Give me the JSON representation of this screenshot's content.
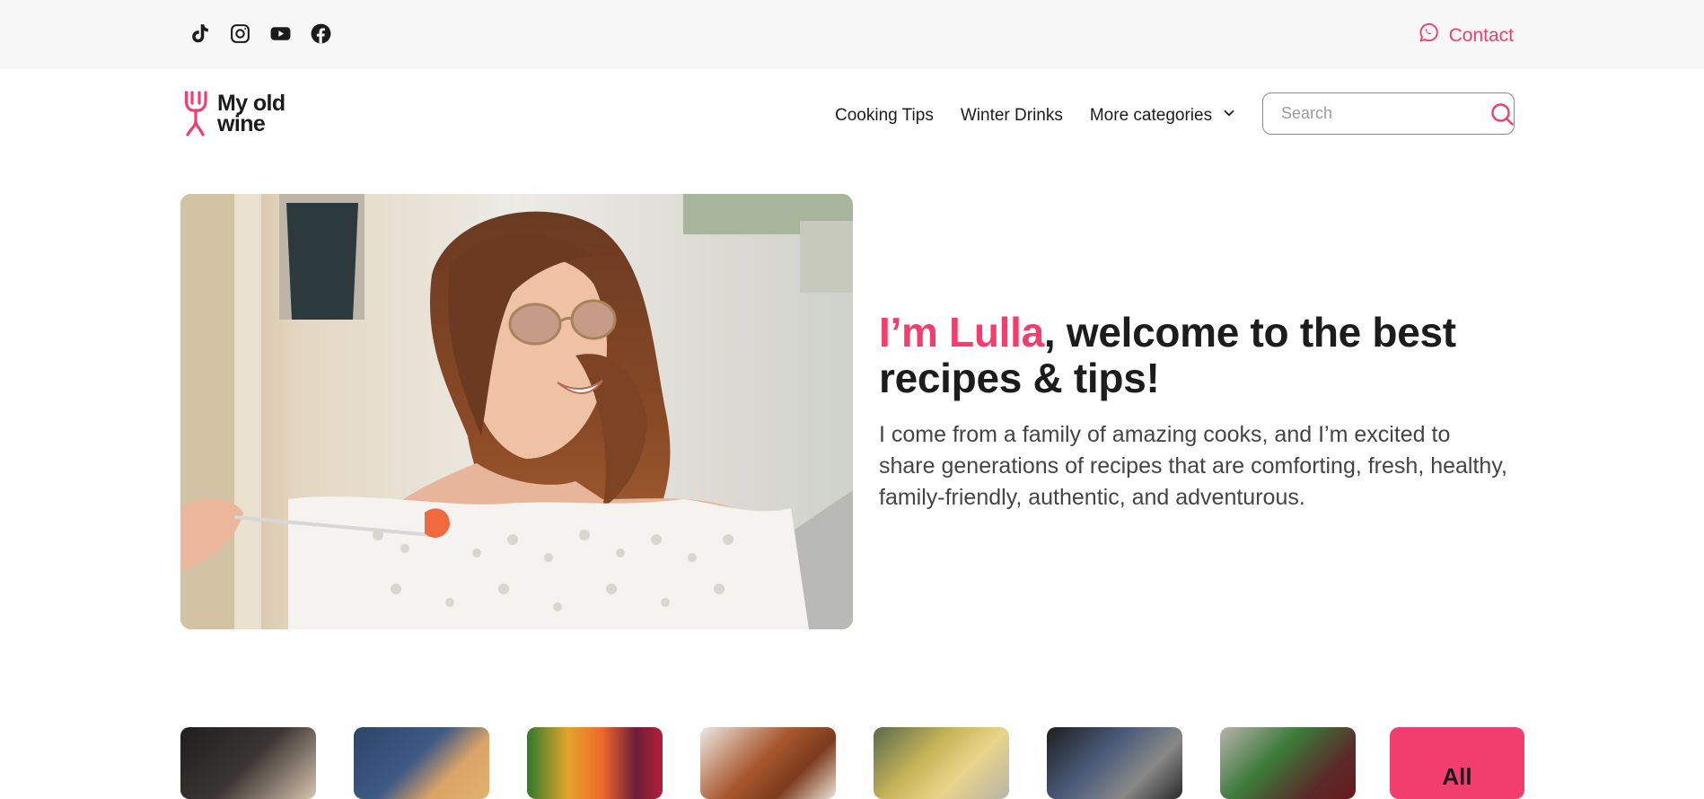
{
  "topbar": {
    "social": [
      {
        "icon": "tiktok-icon"
      },
      {
        "icon": "instagram-icon"
      },
      {
        "icon": "youtube-icon"
      },
      {
        "icon": "facebook-icon"
      }
    ],
    "contact_label": "Contact",
    "contact_icon": "whatsapp-icon"
  },
  "logo": {
    "line1": "My old",
    "line2": "wine"
  },
  "nav": {
    "items": [
      "Cooking Tips",
      "Winter Drinks",
      "More categories"
    ],
    "dropdown_icon": "chevron-down-icon"
  },
  "search": {
    "placeholder": "Search",
    "icon": "search-icon"
  },
  "hero": {
    "title_accent": "I’m Lulla",
    "title_rest": ", welcome to the best recipes & tips!",
    "description": "I come from a family of amazing cooks, and I’m excited to share generations of recipes that are comforting, fresh, healthy, family-friendly, authentic, and adventurous."
  },
  "categories": {
    "all_label": "All"
  },
  "colors": {
    "accent": "#f23e6f",
    "topbar_bg": "#f7f7f7",
    "text": "#1c1c1c",
    "muted": "#444444"
  }
}
